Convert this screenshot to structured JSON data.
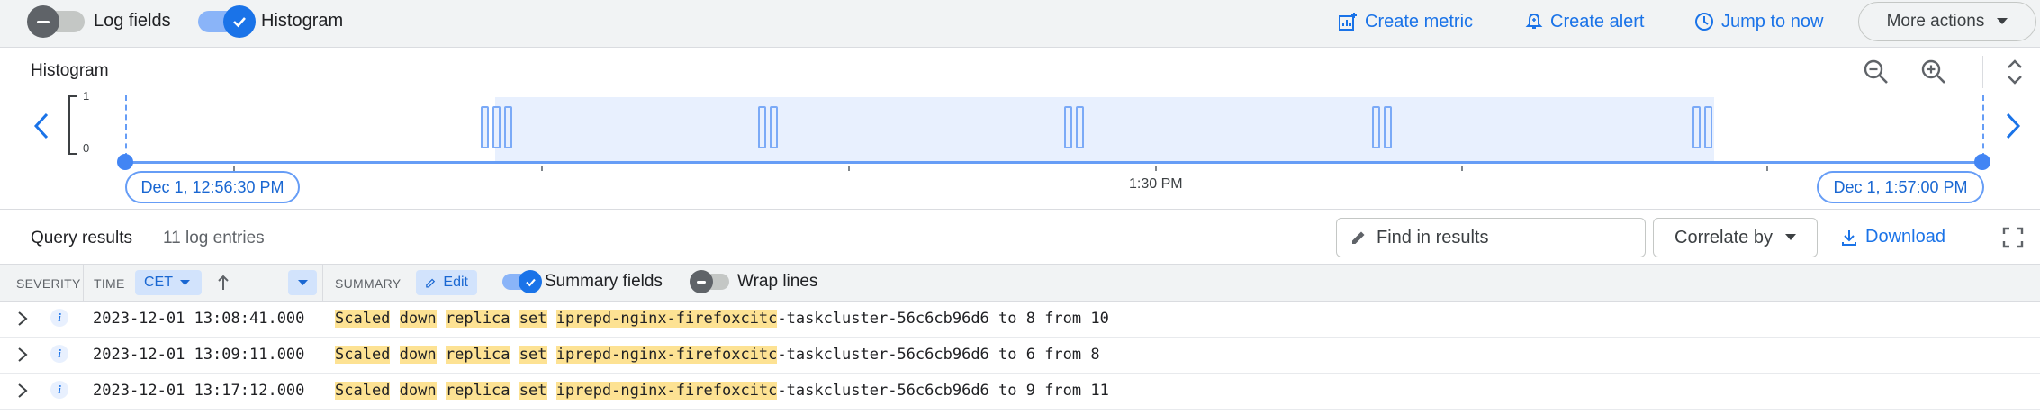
{
  "toolbar": {
    "log_fields_label": "Log fields",
    "histogram_label": "Histogram",
    "log_fields_on": false,
    "histogram_on": true,
    "create_metric": "Create metric",
    "create_alert": "Create alert",
    "jump_to_now": "Jump to now",
    "more_actions": "More actions"
  },
  "histogram": {
    "title": "Histogram",
    "y_max": "1",
    "y_min": "0",
    "start_label": "Dec 1, 12:56:30 PM",
    "mid_label": "1:30 PM",
    "end_label": "Dec 1, 1:57:00 PM"
  },
  "chart_data": {
    "type": "bar",
    "title": "Histogram",
    "x_range": [
      "Dec 1, 12:56:30 PM",
      "Dec 1, 1:57:00 PM"
    ],
    "ylim": [
      0,
      1
    ],
    "bucket_groups": [
      {
        "count": 3,
        "value": 1
      },
      {
        "count": 2,
        "value": 1
      },
      {
        "count": 2,
        "value": 1
      },
      {
        "count": 2,
        "value": 1
      },
      {
        "count": 2,
        "value": 1
      }
    ]
  },
  "results": {
    "title": "Query results",
    "count": "11 log entries",
    "find_placeholder": "Find in results",
    "correlate_by": "Correlate by",
    "download": "Download"
  },
  "table": {
    "severity_header": "SEVERITY",
    "time_header": "TIME",
    "timezone": "CET",
    "summary_header": "SUMMARY",
    "edit_label": "Edit",
    "summary_fields_label": "Summary fields",
    "wrap_lines_label": "Wrap lines",
    "rows": [
      {
        "severity": "i",
        "time": "2023-12-01 13:08:41.000",
        "parts": [
          "Scaled",
          "down",
          "replica",
          "set",
          "iprepd-nginx-firefoxcitc"
        ],
        "rest": "-taskcluster-56c6cb96d6 to 8 from 10"
      },
      {
        "severity": "i",
        "time": "2023-12-01 13:09:11.000",
        "parts": [
          "Scaled",
          "down",
          "replica",
          "set",
          "iprepd-nginx-firefoxcitc"
        ],
        "rest": "-taskcluster-56c6cb96d6 to 6 from 8"
      },
      {
        "severity": "i",
        "time": "2023-12-01 13:17:12.000",
        "parts": [
          "Scaled",
          "down",
          "replica",
          "set",
          "iprepd-nginx-firefoxcitc"
        ],
        "rest": "-taskcluster-56c6cb96d6 to 9 from 11"
      }
    ]
  }
}
